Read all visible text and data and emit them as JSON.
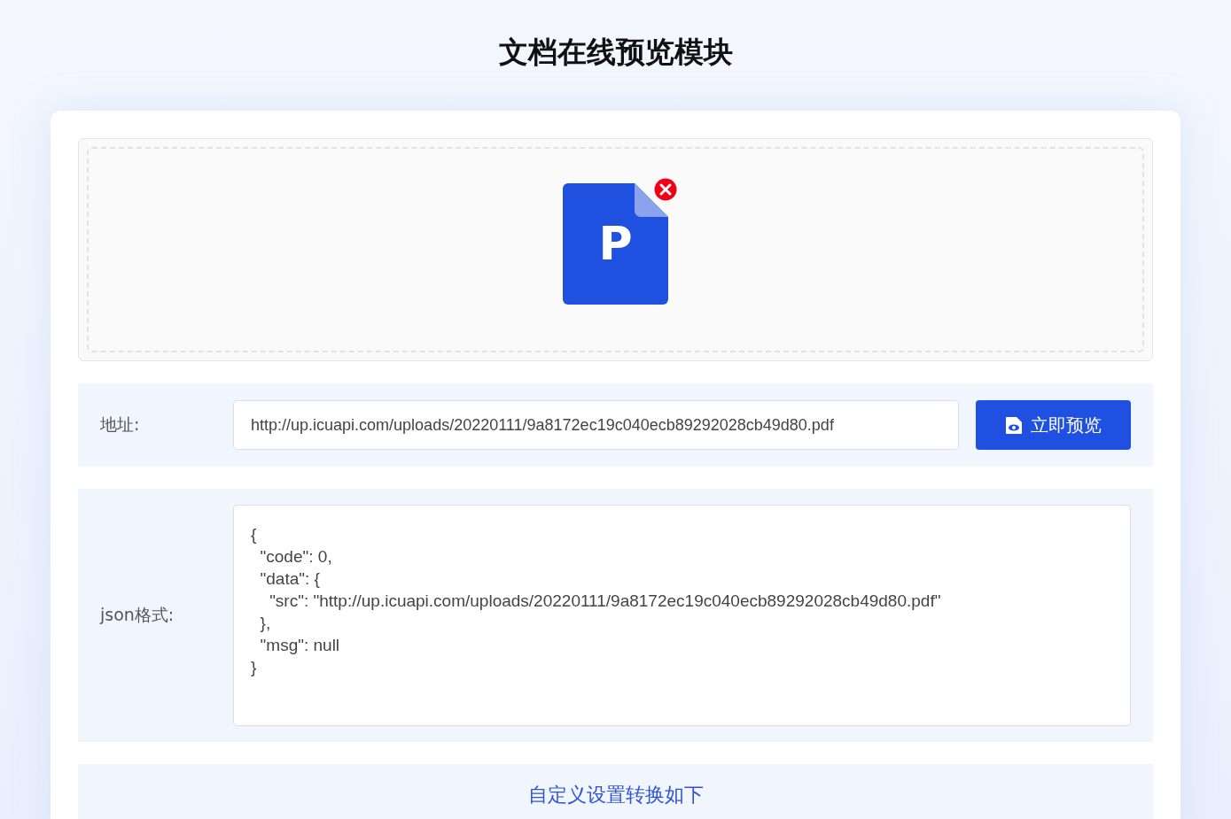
{
  "title": "文档在线预览模块",
  "upload": {
    "file_letter": "P",
    "removable": true
  },
  "address": {
    "label": "地址:",
    "value": "http://up.icuapi.com/uploads/20220111/9a8172ec19c040ecb89292028cb49d80.pdf",
    "button": "立即预览"
  },
  "json": {
    "label": "json格式:",
    "value": "{\n  \"code\": 0,\n  \"data\": {\n    \"src\": \"http://up.icuapi.com/uploads/20220111/9a8172ec19c040ecb89292028cb49d80.pdf\"\n  },\n  \"msg\": null\n}"
  },
  "custom_link": "自定义设置转换如下"
}
